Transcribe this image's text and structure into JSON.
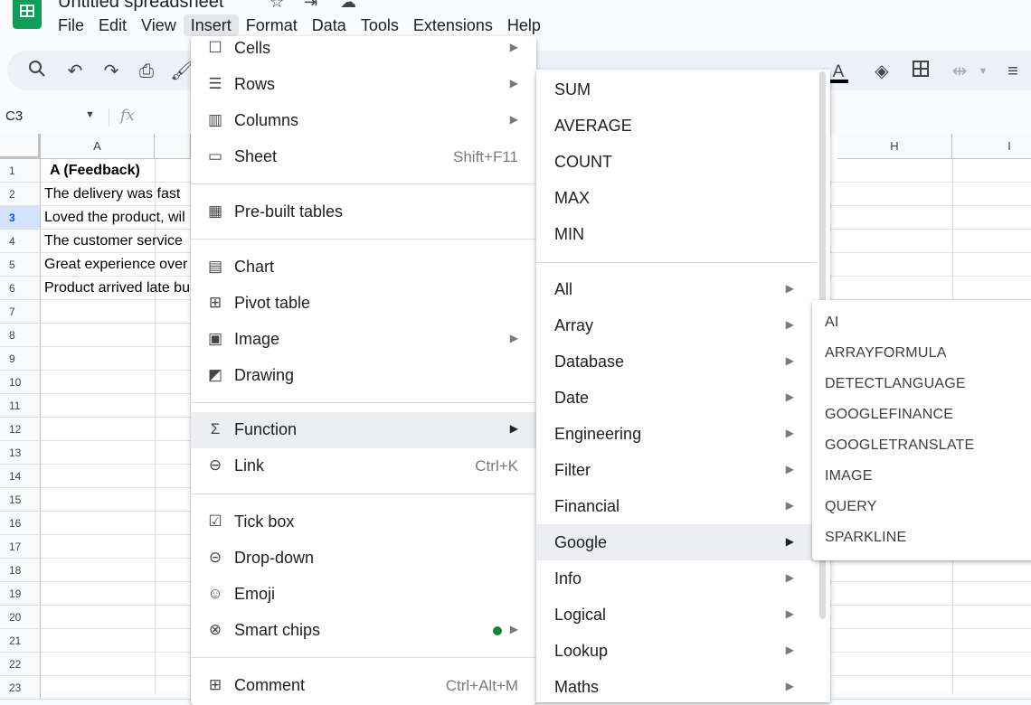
{
  "app": {
    "title": "Untitled spreadsheet",
    "icon": "sheets-logo-icon"
  },
  "menubar": [
    "File",
    "Edit",
    "View",
    "Insert",
    "Format",
    "Data",
    "Tools",
    "Extensions",
    "Help"
  ],
  "formula_bar": {
    "cell_ref": "C3",
    "fx": "fx"
  },
  "columns": [
    "A",
    "H",
    "I"
  ],
  "rows": [
    "1",
    "2",
    "3",
    "4",
    "5",
    "6",
    "7",
    "8",
    "9",
    "10",
    "11",
    "12",
    "13",
    "14",
    "15",
    "16",
    "17",
    "18",
    "19",
    "20",
    "21",
    "22",
    "23"
  ],
  "selected_row": "3",
  "cells": [
    {
      "row": "1",
      "text": "A (Feedback)",
      "bold": true
    },
    {
      "row": "2",
      "text": "The delivery was fast"
    },
    {
      "row": "3",
      "text": "Loved the product, wil"
    },
    {
      "row": "4",
      "text": "The customer service"
    },
    {
      "row": "5",
      "text": "Great experience over"
    },
    {
      "row": "6",
      "text": "Product arrived late bu"
    }
  ],
  "insert_menu": {
    "items": [
      {
        "label": "Cells",
        "icon": "cells-icon",
        "submenu": true
      },
      {
        "label": "Rows",
        "icon": "rows-icon",
        "submenu": true
      },
      {
        "label": "Columns",
        "icon": "columns-icon",
        "submenu": true
      },
      {
        "label": "Sheet",
        "icon": "sheet-icon",
        "shortcut": "Shift+F11"
      },
      {
        "label": "Pre-built tables",
        "icon": "table-icon"
      },
      {
        "label": "Chart",
        "icon": "chart-icon"
      },
      {
        "label": "Pivot table",
        "icon": "pivot-table-icon"
      },
      {
        "label": "Image",
        "icon": "image-icon",
        "submenu": true
      },
      {
        "label": "Drawing",
        "icon": "drawing-icon"
      },
      {
        "label": "Function",
        "icon": "sigma-icon",
        "submenu": true,
        "highlighted": true
      },
      {
        "label": "Link",
        "icon": "link-icon",
        "shortcut": "Ctrl+K"
      },
      {
        "label": "Tick box",
        "icon": "checkbox-icon"
      },
      {
        "label": "Drop-down",
        "icon": "dropdown-icon"
      },
      {
        "label": "Emoji",
        "icon": "emoji-icon"
      },
      {
        "label": "Smart chips",
        "icon": "smart-chips-icon",
        "submenu": true,
        "new_dot_color": "#188038"
      },
      {
        "label": "Comment",
        "icon": "comment-icon",
        "shortcut": "Ctrl+Alt+M"
      }
    ]
  },
  "function_menu": {
    "quick": [
      "SUM",
      "AVERAGE",
      "COUNT",
      "MAX",
      "MIN"
    ],
    "categories": [
      "All",
      "Array",
      "Database",
      "Date",
      "Engineering",
      "Filter",
      "Financial",
      "Google",
      "Info",
      "Logical",
      "Lookup",
      "Maths"
    ],
    "highlighted": "Google"
  },
  "google_menu": {
    "items": [
      "AI",
      "ARRAYFORMULA",
      "DETECTLANGUAGE",
      "GOOGLEFINANCE",
      "GOOGLETRANSLATE",
      "IMAGE",
      "QUERY",
      "SPARKLINE"
    ]
  },
  "toolbar_icons": [
    "search-icon",
    "undo-icon",
    "redo-icon",
    "print-icon",
    "paint-format-icon",
    "text-color-icon",
    "fill-color-icon",
    "borders-icon",
    "merge-cells-icon",
    "align-icon"
  ]
}
